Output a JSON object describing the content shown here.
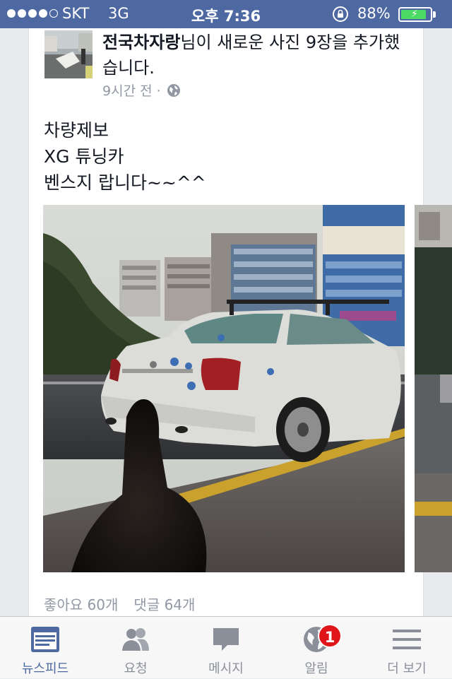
{
  "status_bar": {
    "carrier": "SKT",
    "network": "3G",
    "time": "오후 7:36",
    "battery_percent": "88%",
    "battery_level": 0.88
  },
  "post": {
    "author": "전국차자랑",
    "action": "님이 새로운 사진 9장을 추가했습니다.",
    "time_ago": "9시간 전 ·",
    "text_lines": [
      "차량제보",
      "XG 튜닝카",
      "벤스지 랍니다~~^^"
    ],
    "likes": "좋아요 60개",
    "comments": "댓글 64개"
  },
  "tabs": [
    {
      "label": "뉴스피드",
      "icon": "news-feed-icon",
      "active": true
    },
    {
      "label": "요청",
      "icon": "friend-requests-icon",
      "active": false
    },
    {
      "label": "메시지",
      "icon": "messages-icon",
      "active": false
    },
    {
      "label": "알림",
      "icon": "notifications-globe-icon",
      "active": false,
      "badge": "1"
    },
    {
      "label": "더 보기",
      "icon": "more-menu-icon",
      "active": false
    }
  ],
  "colors": {
    "brand": "#4e69a2",
    "badge": "#e0151a",
    "battery": "#4cd964"
  }
}
